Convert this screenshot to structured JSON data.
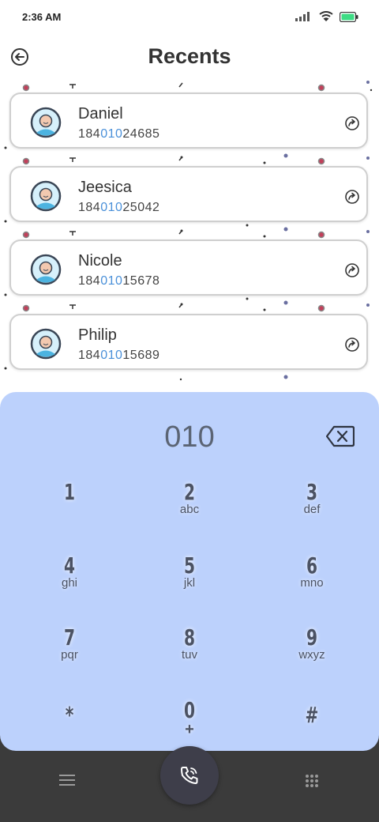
{
  "status_bar": {
    "time": "2:36 AM",
    "icons": [
      "signal-icon",
      "wifi-icon",
      "battery-icon"
    ],
    "battery_color": "#3ddc84"
  },
  "header": {
    "title": "Recents",
    "back_icon": "back-arrow-icon"
  },
  "contacts": [
    {
      "name": "Daniel",
      "number_prefix": "184",
      "number_match": "010",
      "number_suffix": "24685"
    },
    {
      "name": "Jeesica",
      "number_prefix": "184",
      "number_match": "010",
      "number_suffix": "25042"
    },
    {
      "name": "Nicole",
      "number_prefix": "184",
      "number_match": "010",
      "number_suffix": "15678"
    },
    {
      "name": "Philip",
      "number_prefix": "184",
      "number_match": "010",
      "number_suffix": "15689"
    }
  ],
  "dialer": {
    "display": "010",
    "keys": [
      {
        "digit": "1",
        "letters": ""
      },
      {
        "digit": "2",
        "letters": "abc"
      },
      {
        "digit": "3",
        "letters": "def"
      },
      {
        "digit": "4",
        "letters": "ghi"
      },
      {
        "digit": "5",
        "letters": "jkl"
      },
      {
        "digit": "6",
        "letters": "mno"
      },
      {
        "digit": "7",
        "letters": "pqr"
      },
      {
        "digit": "8",
        "letters": "tuv"
      },
      {
        "digit": "9",
        "letters": "wxyz"
      },
      {
        "digit": "*",
        "letters": ""
      },
      {
        "digit": "0",
        "letters": "+"
      },
      {
        "digit": "#",
        "letters": ""
      }
    ]
  },
  "bottom_nav": {
    "left_icon": "menu-icon",
    "center_icon": "phone-call-icon",
    "right_icon": "keypad-icon"
  },
  "colors": {
    "dialer_bg": "#bcd1fc",
    "match_highlight": "#4a90d9",
    "nav_bg": "#3b3b3b",
    "call_button": "#3e3e4a"
  }
}
